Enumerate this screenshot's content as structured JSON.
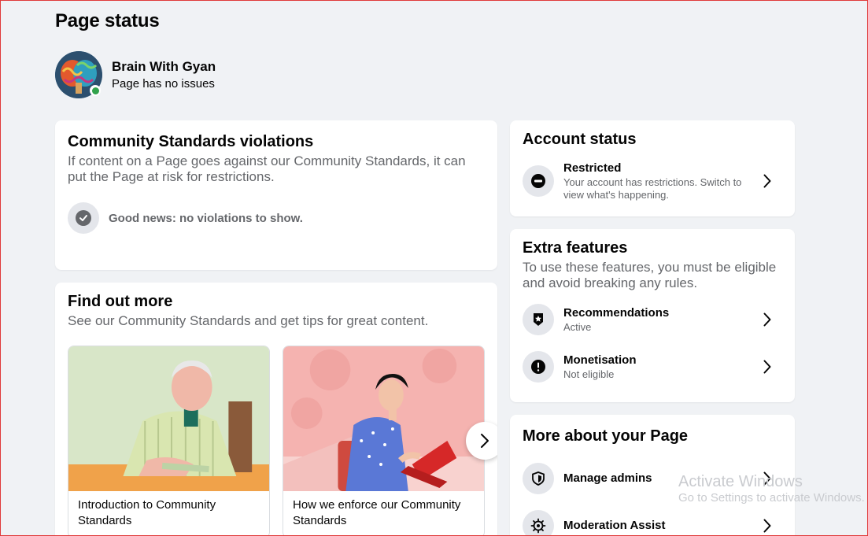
{
  "page": {
    "title": "Page status"
  },
  "profile": {
    "name": "Brain With Gyan",
    "status": "Page has no issues"
  },
  "violations": {
    "title": "Community Standards violations",
    "description": "If content on a Page goes against our Community Standards, it can put the Page at risk for restrictions.",
    "good_news": "Good news: no violations to show."
  },
  "find_out_more": {
    "title": "Find out more",
    "description": "See our Community Standards and get tips for great content.",
    "tiles": [
      {
        "caption": "Introduction to Community Standards"
      },
      {
        "caption": "How we enforce our Community Standards"
      }
    ]
  },
  "account_status": {
    "title": "Account status",
    "item": {
      "label": "Restricted",
      "sub": "Your account has restrictions. Switch to view what's happening."
    }
  },
  "extra_features": {
    "title": "Extra features",
    "description": "To use these features, you must be eligible and avoid breaking any rules.",
    "items": [
      {
        "label": "Recommendations",
        "sub": "Active",
        "icon": "badge-star-icon"
      },
      {
        "label": "Monetisation",
        "sub": "Not eligible",
        "icon": "exclamation-icon"
      }
    ]
  },
  "more_about": {
    "title": "More about your Page",
    "items": [
      {
        "label": "Manage admins",
        "icon": "shield-icon"
      },
      {
        "label": "Moderation Assist",
        "icon": "gear-icon"
      }
    ]
  },
  "watermark": {
    "title": "Activate Windows",
    "sub": "Go to Settings to activate Windows."
  },
  "colors": {
    "background": "#f0f2f5",
    "card": "#ffffff",
    "secondary_text": "#65676b",
    "online": "#31a24c",
    "icon_bg": "#e4e6eb"
  }
}
